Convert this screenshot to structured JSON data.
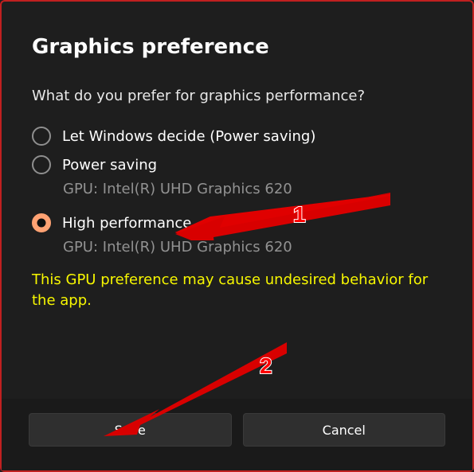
{
  "dialog": {
    "title": "Graphics preference",
    "prompt": "What do you prefer for graphics performance?",
    "options": [
      {
        "label": "Let Windows decide (Power saving)",
        "detail": null,
        "selected": false
      },
      {
        "label": "Power saving",
        "detail": "GPU: Intel(R) UHD Graphics 620",
        "selected": false
      },
      {
        "label": "High performance",
        "detail": "GPU: Intel(R) UHD Graphics 620",
        "selected": true
      }
    ],
    "warning": "This GPU preference may cause undesired behavior for the app.",
    "buttons": {
      "save": "Save",
      "cancel": "Cancel"
    }
  },
  "annotations": {
    "arrow1_num": "1",
    "arrow2_num": "2"
  }
}
